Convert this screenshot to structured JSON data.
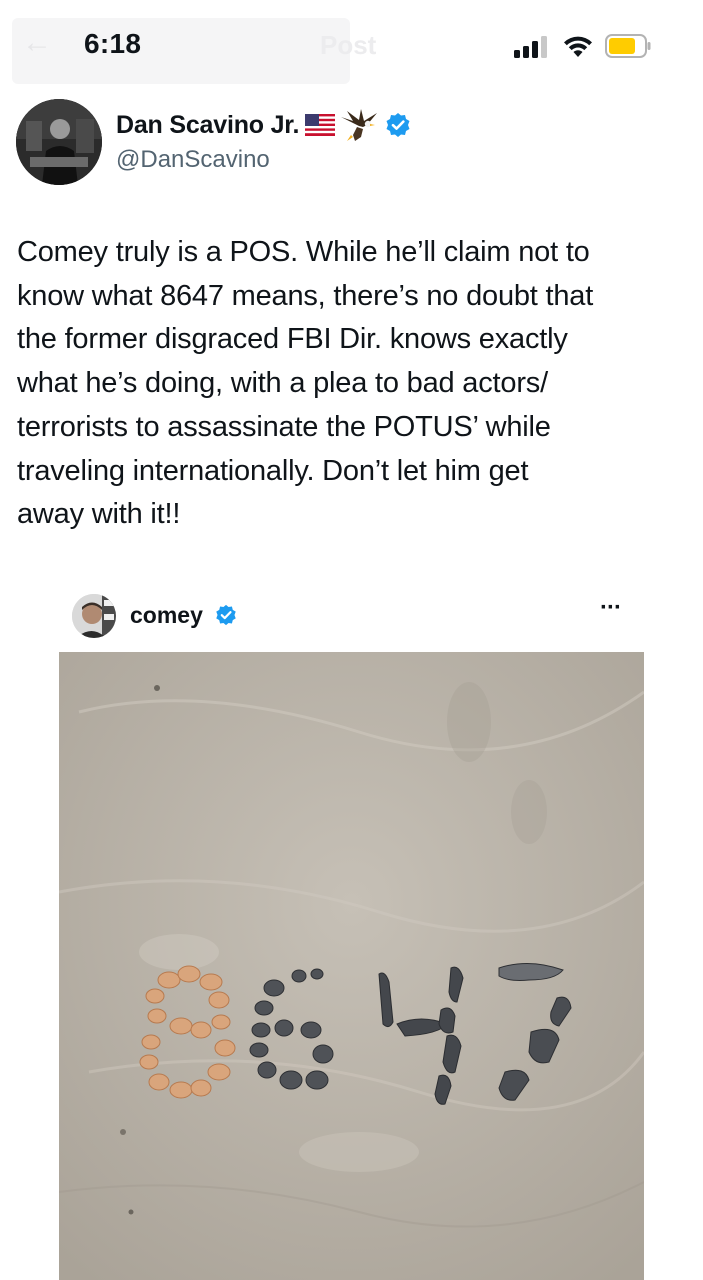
{
  "status_bar": {
    "time": "6:18",
    "ghost_title": "Post",
    "icons": [
      "signal-icon",
      "wifi-icon",
      "battery-icon"
    ],
    "battery_color": "#ffcc00"
  },
  "author": {
    "display_name": "Dan Scavino Jr.",
    "handle": "@DanScavino",
    "badges": [
      "us-flag-icon",
      "eagle-icon",
      "verified-icon"
    ],
    "verified_color": "#1d9bf0"
  },
  "tweet": {
    "text": "Comey truly is a POS. While he’ll claim not to\nknow what 8647 means, there’s no doubt that\nthe former disgraced FBI Dir. knows exactly\nwhat he’s doing, with a plea to bad actors/\nterrorists to assassinate the POTUS’ while\ntraveling internationally. Don’t let him get\naway with it!!"
  },
  "embedded_post": {
    "author_name": "comey",
    "verified": true,
    "more_label": "···",
    "photo": {
      "subject": "shells-in-sand-photo"
    }
  }
}
